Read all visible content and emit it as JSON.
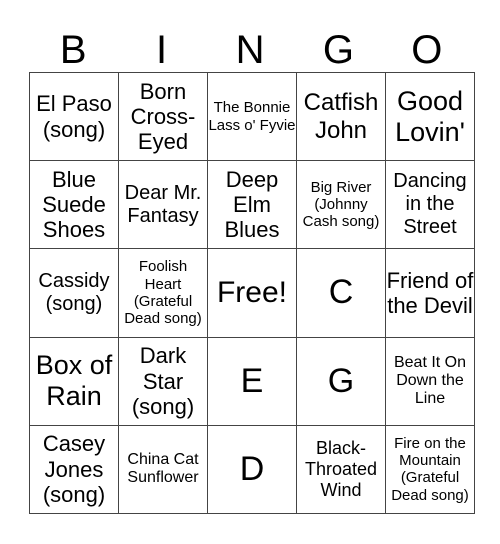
{
  "header": {
    "letters": [
      "B",
      "I",
      "N",
      "G",
      "O"
    ]
  },
  "grid": {
    "rows": [
      [
        "El Paso (song)",
        "Born Cross-Eyed",
        "The Bonnie Lass o' Fyvie",
        "Catfish John",
        "Good Lovin'"
      ],
      [
        "Blue Suede Shoes",
        "Dear Mr. Fantasy",
        "Deep Elm Blues",
        "Big River (Johnny Cash song)",
        "Dancing in the Street"
      ],
      [
        "Cassidy (song)",
        "Foolish Heart (Grateful Dead song)",
        "Free!",
        "C",
        "Friend of the Devil"
      ],
      [
        "Box of Rain",
        "Dark Star (song)",
        "E",
        "G",
        "Beat It On Down the Line"
      ],
      [
        "Casey Jones (song)",
        "China Cat Sunflower",
        "D",
        "Black-Throated Wind",
        "Fire on the Mountain (Grateful Dead song)"
      ]
    ]
  }
}
